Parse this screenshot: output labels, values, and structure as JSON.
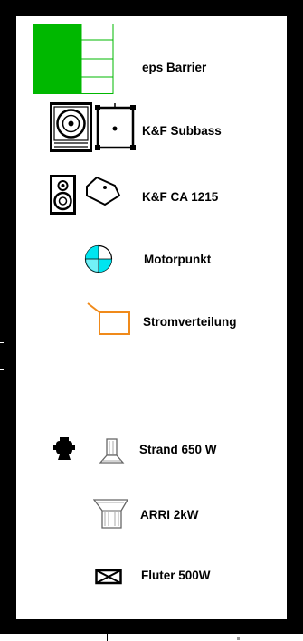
{
  "legend": {
    "items": [
      {
        "label": "eps Barrier",
        "icon": "barrier-icon",
        "color": "#00b800"
      },
      {
        "label": "K&F Subbass",
        "icon": "subbass-speaker-icon"
      },
      {
        "label": "K&F CA 1215",
        "icon": "ca1215-speaker-icon"
      },
      {
        "label": "Motorpunkt",
        "icon": "motor-point-icon",
        "color": "#00e5f0"
      },
      {
        "label": "Stromverteilung",
        "icon": "power-distribution-icon",
        "color": "#f08a1a"
      },
      {
        "label": "Strand 650 W",
        "icon": "strand-650-lamp-icon"
      },
      {
        "label": "ARRI 2kW",
        "icon": "arri-2kw-lamp-icon"
      },
      {
        "label": "Fluter 500W",
        "icon": "floodlight-icon"
      }
    ]
  }
}
